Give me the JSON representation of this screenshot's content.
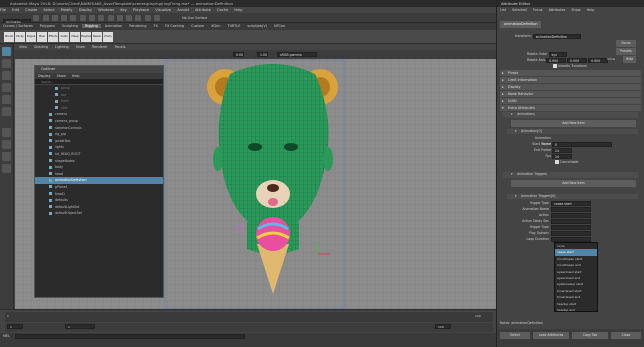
{
  "window_title": "Autodesk Maya 2018: D:\\work\\Client\\NAMESAKE_AssetTemplate\\scenes\\playing\\ringThing.ma* — animationDefinition",
  "menu": [
    "File",
    "Edit",
    "Create",
    "Select",
    "Modify",
    "Display",
    "Windows",
    "Key",
    "Playback",
    "Visualize",
    "Arnold",
    "Attribute",
    "Cache",
    "Help"
  ],
  "toolbar": {
    "mode": "Animation",
    "live_surface": "No Live Surface"
  },
  "shelf_tabs": [
    "Curves / Surfaces",
    "Polygons",
    "Sculpting",
    "Rigging",
    "Animation",
    "Rendering",
    "FX",
    "FX Caching",
    "Custom",
    "XGen",
    "TURTLE",
    "scriptJob(V)",
    "NTCon"
  ],
  "shelf_active_tab": "Rigging",
  "shelf_buttons": [
    "Studio",
    "Packy",
    "Paypal",
    "Main",
    "Effects",
    "Audio",
    "Meep",
    "Playbast",
    "Raster Pipeline",
    "Photo"
  ],
  "viewport": {
    "menu": [
      "View",
      "Shading",
      "Lighting",
      "Show",
      "Renderer",
      "Panels"
    ],
    "gamma": "sRGB gamma",
    "val1": "0.00",
    "val2": "1.00"
  },
  "outliner": {
    "title": "Outliner",
    "menu": [
      "Display",
      "Show",
      "Help"
    ],
    "search": "Search...",
    "items": [
      {
        "label": "persp",
        "dim": true
      },
      {
        "label": "top",
        "dim": true
      },
      {
        "label": "front",
        "dim": true
      },
      {
        "label": "side",
        "dim": true
      },
      {
        "label": "camera"
      },
      {
        "label": "camera_group"
      },
      {
        "label": "skeletonControls"
      },
      {
        "label": "rig_grp"
      },
      {
        "label": "jacketTwo"
      },
      {
        "label": "lights"
      },
      {
        "label": "hd_HEAD_ROOT"
      },
      {
        "label": "shapeNodes"
      },
      {
        "label": "body"
      },
      {
        "label": "head"
      },
      {
        "label": "animationDefinition",
        "sel": true
      },
      {
        "label": "pPlane1"
      },
      {
        "label": "head1"
      },
      {
        "label": "defaults"
      },
      {
        "label": "defaultLightSet"
      },
      {
        "label": "defaultObjectSet"
      }
    ]
  },
  "timeline": {
    "start": "1",
    "end": "120",
    "current": "1"
  },
  "cmd": {
    "label": "MEL"
  },
  "attribute_editor": {
    "title": "Attribute Editor",
    "menu": [
      "List",
      "Selected",
      "Focus",
      "Attributes",
      "Show",
      "Help"
    ],
    "tab": "animationDefinition",
    "transform_label": "transform:",
    "transform_value": "animationDefinition",
    "focus_btn": "Focus",
    "presets_btn": "Presets",
    "show_label": "Show",
    "hide_btn": "Hide",
    "rotate_order_label": "Rotate Order",
    "rotate_order_value": "xyz",
    "rotate_axis_label": "Rotate Axis",
    "rotate_axis": [
      "0.000",
      "0.000",
      "0.000"
    ],
    "inherits_label": "Inherits Transform",
    "sections": [
      "Pivots",
      "Limit Information",
      "Display",
      "Node Behavior",
      "UUID",
      "Extra Attributes"
    ],
    "animations_section": "Animations",
    "add_new_item": "Add New Item",
    "animation_sub": "Animation[0]",
    "anim_fields": [
      {
        "label": "Animation Name",
        "value": "nap"
      },
      {
        "label": "Start Frame",
        "value": "0"
      },
      {
        "label": "End Frame",
        "value": "24"
      },
      {
        "label": "Fps",
        "value": "24"
      }
    ],
    "cancellable_label": "Cancellable",
    "triggers_section": "Animation Triggers",
    "trigger_sub": "Animation Triggers[0]",
    "trigger_fields": [
      "Trigger Type",
      "Animation Name",
      "Action",
      "Action Delay Sec",
      "Trigger Type",
      "Play Options",
      "Loop Duration"
    ],
    "trigger_type_value": "cease start",
    "notes_label": "Notes:",
    "notes_value": "animationDefinition",
    "bottom_buttons": [
      "Select",
      "Load Attributes",
      "Copy Tab",
      "Close"
    ]
  },
  "dropdown": {
    "items": [
      "none",
      "cease start",
      "mouthopen start",
      "mouthopen end",
      "eyesclosed start",
      "eyesclosed end",
      "eyebrowsup start",
      "browraised start",
      "browraised end",
      "headup start",
      "headup end"
    ],
    "highlighted": 1
  },
  "colors": {
    "accent": "#5285a6",
    "mesh": "#2a9a5a",
    "ears": "#d9a23a",
    "ice_cream": "#e84fa0"
  }
}
